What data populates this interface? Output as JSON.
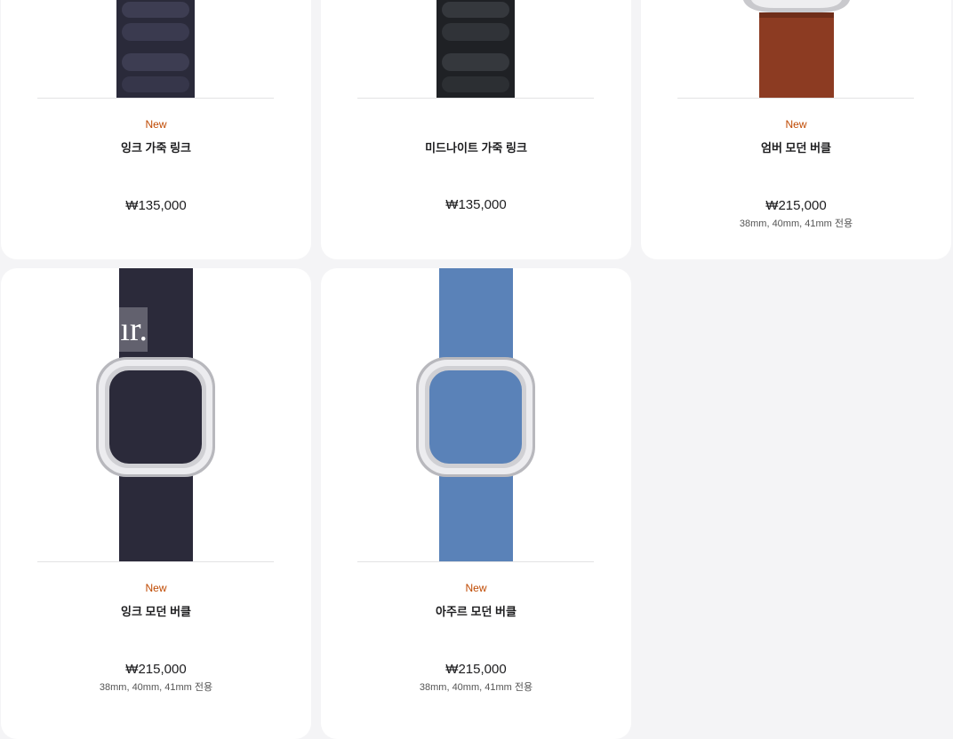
{
  "products": [
    {
      "badge": "New",
      "name": "잉크 가죽 링크",
      "price": "₩135,000",
      "note": ""
    },
    {
      "badge": "",
      "name": "미드나이트 가죽 링크",
      "price": "₩135,000",
      "note": ""
    },
    {
      "badge": "New",
      "name": "엄버 모던 버클",
      "price": "₩215,000",
      "note": "38mm, 40mm, 41mm 전용"
    },
    {
      "badge": "New",
      "name": "잉크 모던 버클",
      "price": "₩215,000",
      "note": "38mm, 40mm, 41mm 전용"
    },
    {
      "badge": "New",
      "name": "아주르 모던 버클",
      "price": "₩215,000",
      "note": "38mm, 40mm, 41mm 전용"
    }
  ],
  "overlay_fragment": "ır.",
  "colors": {
    "badge": "#bf4800",
    "ink_leather_link": "#2a2a3a",
    "midnight_leather_link": "#1f2125",
    "umber": "#8c3b22",
    "ink_buckle": "#2b2a3a",
    "azure_buckle": "#5a82b8",
    "page_bg": "#f4f4f6"
  }
}
